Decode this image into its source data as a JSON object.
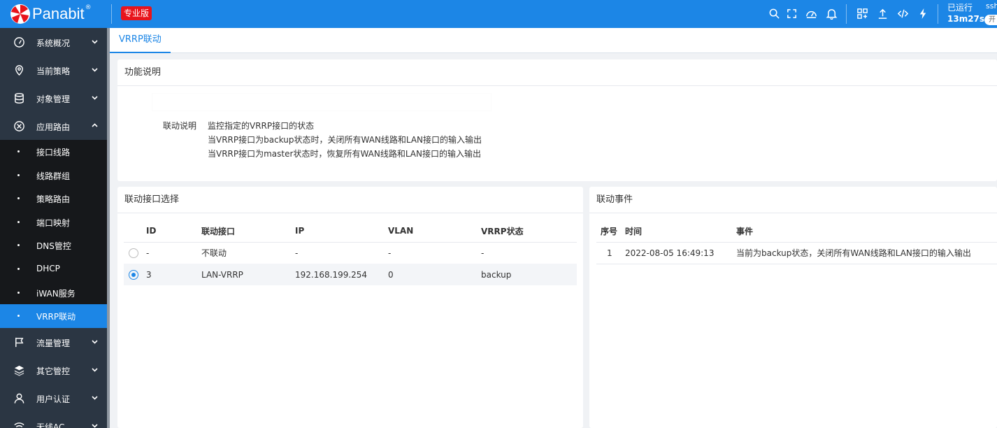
{
  "topbar": {
    "logo_text": "Panabit",
    "logo_reg": "®",
    "edition": "专业版",
    "uptime_label": "已运行",
    "uptime_value": "13m27s",
    "ssh_label": "ssh",
    "ssh_toggle": "开",
    "icons": [
      "search-icon",
      "fullscreen-icon",
      "dashboard-icon",
      "bell-icon",
      "apps-icon",
      "upload-icon",
      "code-icon",
      "lightning-icon"
    ]
  },
  "sidebar": {
    "groups_top": [
      {
        "label": "系统概况",
        "icon": "dashboard-icon"
      },
      {
        "label": "当前策略",
        "icon": "location-icon"
      },
      {
        "label": "对象管理",
        "icon": "database-icon"
      },
      {
        "label": "应用路由",
        "icon": "route-icon"
      }
    ],
    "sub_items": [
      {
        "label": "接口线路"
      },
      {
        "label": "线路群组"
      },
      {
        "label": "策略路由"
      },
      {
        "label": "端口映射"
      },
      {
        "label": "DNS管控"
      },
      {
        "label": "DHCP"
      },
      {
        "label": "iWAN服务"
      },
      {
        "label": "VRRP联动"
      }
    ],
    "groups_bottom": [
      {
        "label": "流量管理",
        "icon": "flag-icon"
      },
      {
        "label": "其它管控",
        "icon": "layers-icon"
      },
      {
        "label": "用户认证",
        "icon": "user-icon"
      },
      {
        "label": "无线AC",
        "icon": "wifi-icon"
      }
    ]
  },
  "tabs": [
    {
      "label": "VRRP联动"
    }
  ],
  "description": {
    "title": "功能说明",
    "label": "联动说明",
    "lines": [
      "监控指定的VRRP接口的状态",
      "当VRRP接口为backup状态时，关闭所有WAN线路和LAN接口的输入输出",
      "当VRRP接口为master状态时，恢复所有WAN线路和LAN接口的输入输出"
    ]
  },
  "interface_select": {
    "title": "联动接口选择",
    "columns": [
      "ID",
      "联动接口",
      "IP",
      "VLAN",
      "VRRP状态"
    ],
    "rows": [
      {
        "selected": false,
        "id": "-",
        "iface": "不联动",
        "ip": "-",
        "vlan": "-",
        "state": "-"
      },
      {
        "selected": true,
        "id": "3",
        "iface": "LAN-VRRP",
        "ip": "192.168.199.254",
        "vlan": "0",
        "state": "backup"
      }
    ]
  },
  "events": {
    "title": "联动事件",
    "columns": [
      "序号",
      "时间",
      "事件"
    ],
    "rows": [
      {
        "no": "1",
        "time": "2022-08-05 16:49:13",
        "event": "当前为backup状态，关闭所有WAN线路和LAN接口的输入输出"
      }
    ]
  },
  "colors": {
    "topbar": "#1c86e6",
    "sidebar": "#2b3643",
    "submenu": "#16181b",
    "active": "#1c86e6",
    "warning": "#ff5722"
  }
}
